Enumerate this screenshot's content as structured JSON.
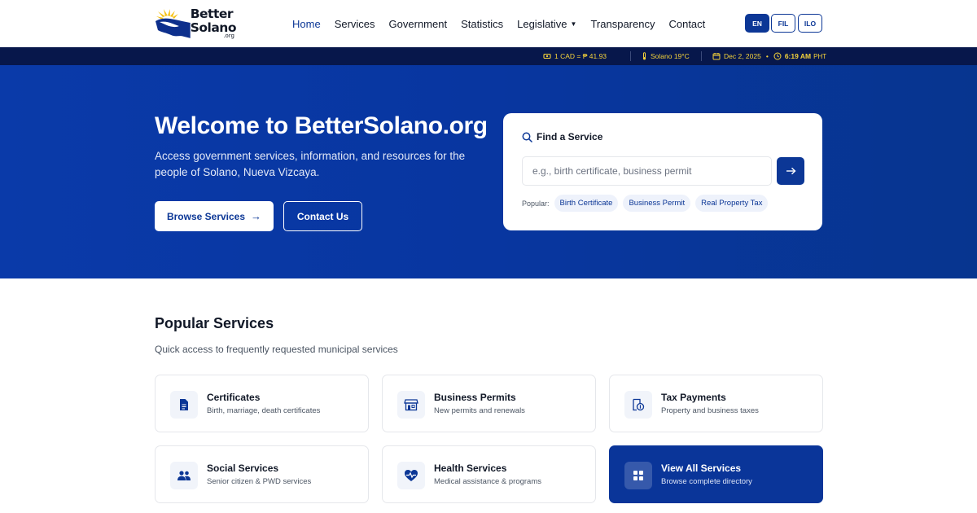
{
  "logo": {
    "line1": "Better",
    "line2": "Solano",
    "tld": ".org"
  },
  "nav": {
    "items": [
      {
        "label": "Home",
        "active": true
      },
      {
        "label": "Services"
      },
      {
        "label": "Government"
      },
      {
        "label": "Statistics"
      },
      {
        "label": "Legislative",
        "dropdown": true
      },
      {
        "label": "Transparency"
      },
      {
        "label": "Contact"
      }
    ]
  },
  "languages": [
    {
      "code": "EN",
      "active": true
    },
    {
      "code": "FIL"
    },
    {
      "code": "ILO"
    }
  ],
  "infobar": {
    "exchange": "1 CAD = ₱ 41.93",
    "weather": "Solano 19°C",
    "date": "Dec 2, 2025",
    "separator": "•",
    "time": "6:19 AM",
    "timezone": "PHT"
  },
  "hero": {
    "title": "Welcome to BetterSolano.org",
    "subtitle": "Access government services, information, and resources for the people of Solano, Nueva Vizcaya.",
    "browse_label": "Browse Services",
    "browse_arrow": "→",
    "contact_label": "Contact Us"
  },
  "search": {
    "heading": "Find a Service",
    "placeholder": "e.g., birth certificate, business permit",
    "popular_label": "Popular:",
    "chips": [
      "Birth Certificate",
      "Business Permit",
      "Real Property Tax"
    ]
  },
  "services": {
    "title": "Popular Services",
    "subtitle": "Quick access to frequently requested municipal services",
    "cards": [
      {
        "title": "Certificates",
        "desc": "Birth, marriage, death certificates",
        "icon": "document-icon"
      },
      {
        "title": "Business Permits",
        "desc": "New permits and renewals",
        "icon": "store-icon"
      },
      {
        "title": "Tax Payments",
        "desc": "Property and business taxes",
        "icon": "tax-receipt-icon"
      },
      {
        "title": "Social Services",
        "desc": "Senior citizen & PWD services",
        "icon": "people-icon"
      },
      {
        "title": "Health Services",
        "desc": "Medical assistance & programs",
        "icon": "heart-pulse-icon"
      },
      {
        "title": "View All Services",
        "desc": "Browse complete directory",
        "icon": "grid-icon"
      }
    ]
  },
  "colors": {
    "brand": "#0c3796",
    "infobar_bg": "#07174b",
    "infobar_text": "#f5d33a"
  }
}
